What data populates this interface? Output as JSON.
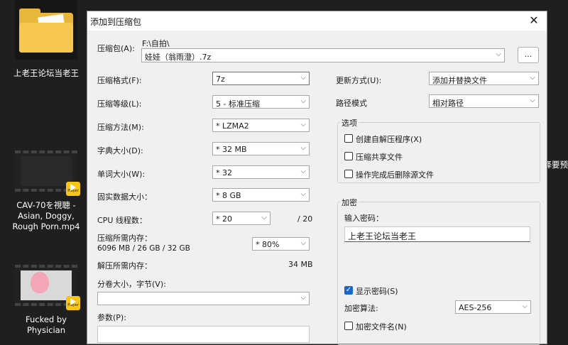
{
  "desktop": {
    "icons": [
      {
        "label": "上老王论坛当老王"
      },
      {
        "label": "CAV-70を視聴 - Asian, Doggy, Rough Porn.mp4",
        "badge": "Player"
      },
      {
        "label": "Fucked by Physician",
        "badge": "Player"
      }
    ],
    "right_edge_text": "择要预"
  },
  "dialog": {
    "title": "添加到压缩包",
    "archive_label": "压缩包(A):",
    "archive_path": "F:\\自拍\\",
    "archive_name": "娃娃（翁雨澄）.7z",
    "browse_label": "...",
    "left": {
      "format_label": "压缩格式(F):",
      "format_value": "7z",
      "level_label": "压缩等级(L):",
      "level_value": "5 - 标准压缩",
      "method_label": "压缩方法(M):",
      "method_value": "* LZMA2",
      "dict_label": "字典大小(D):",
      "dict_value": "* 32 MB",
      "word_label": "单词大小(W):",
      "word_value": "* 32",
      "solid_label": "固实数据大小：",
      "solid_value": "* 8 GB",
      "threads_label": "CPU 线程数：",
      "threads_value": "* 20",
      "threads_max": "/ 20",
      "mem_label": "压缩所需内存：",
      "mem_detail": "6096 MB / 26 GB / 32 GB",
      "mem_value": "* 80%",
      "decomp_label": "解压所需内存：",
      "decomp_value": "34 MB",
      "split_label": "分卷大小，字节(V):",
      "split_value": "",
      "params_label": "参数(P):"
    },
    "right": {
      "update_label": "更新方式(U):",
      "update_value": "添加并替换文件",
      "path_label": "路径模式",
      "path_value": "相对路径",
      "options_title": "选项",
      "opt_sfx": "创建自解压程序(X)",
      "opt_shared": "压缩共享文件",
      "opt_delete": "操作完成后删除源文件",
      "encrypt_title": "加密",
      "password_label": "输入密码：",
      "password_value": "上老王论坛当老王",
      "show_pwd": "显示密码(S)",
      "algo_label": "加密算法:",
      "algo_value": "AES-256",
      "encrypt_names": "加密文件名(N)"
    }
  }
}
